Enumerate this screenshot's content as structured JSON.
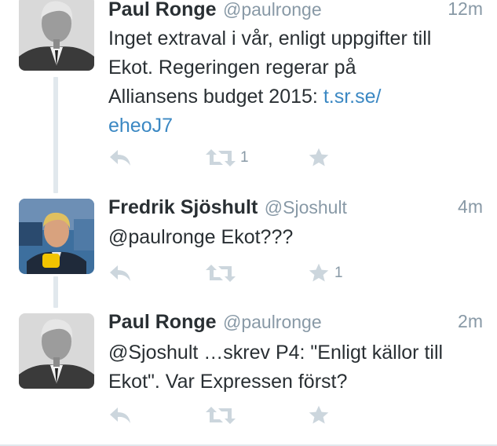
{
  "colors": {
    "link": "#3b88c3",
    "muted": "#8899a6",
    "text": "#292f33",
    "icon": "#ccd6dd",
    "thread_line": "#e1e8ed"
  },
  "tweets": [
    {
      "name": "Paul Ronge",
      "handle": "@paulronge",
      "time": "12m",
      "text_lines": [
        "Inget extraval i vår, enligt uppgifter till",
        "Ekot. Regeringen regerar på",
        "Alliansens budget 2015: "
      ],
      "link_part1": "t.sr.se/",
      "link_part2": "eheoJ7",
      "reply_count": "",
      "retweet_count": "1",
      "favorite_count": ""
    },
    {
      "name": "Fredrik Sjöshult",
      "handle": "@Sjoshult",
      "time": "4m",
      "text": "@paulronge Ekot???",
      "reply_count": "",
      "retweet_count": "",
      "favorite_count": "1"
    },
    {
      "name": "Paul Ronge",
      "handle": "@paulronge",
      "time": "2m",
      "text_lines": [
        "@Sjoshult …skrev P4: \"Enligt källor till",
        "Ekot\". Var Expressen först?"
      ],
      "reply_count": "",
      "retweet_count": "",
      "favorite_count": ""
    }
  ]
}
